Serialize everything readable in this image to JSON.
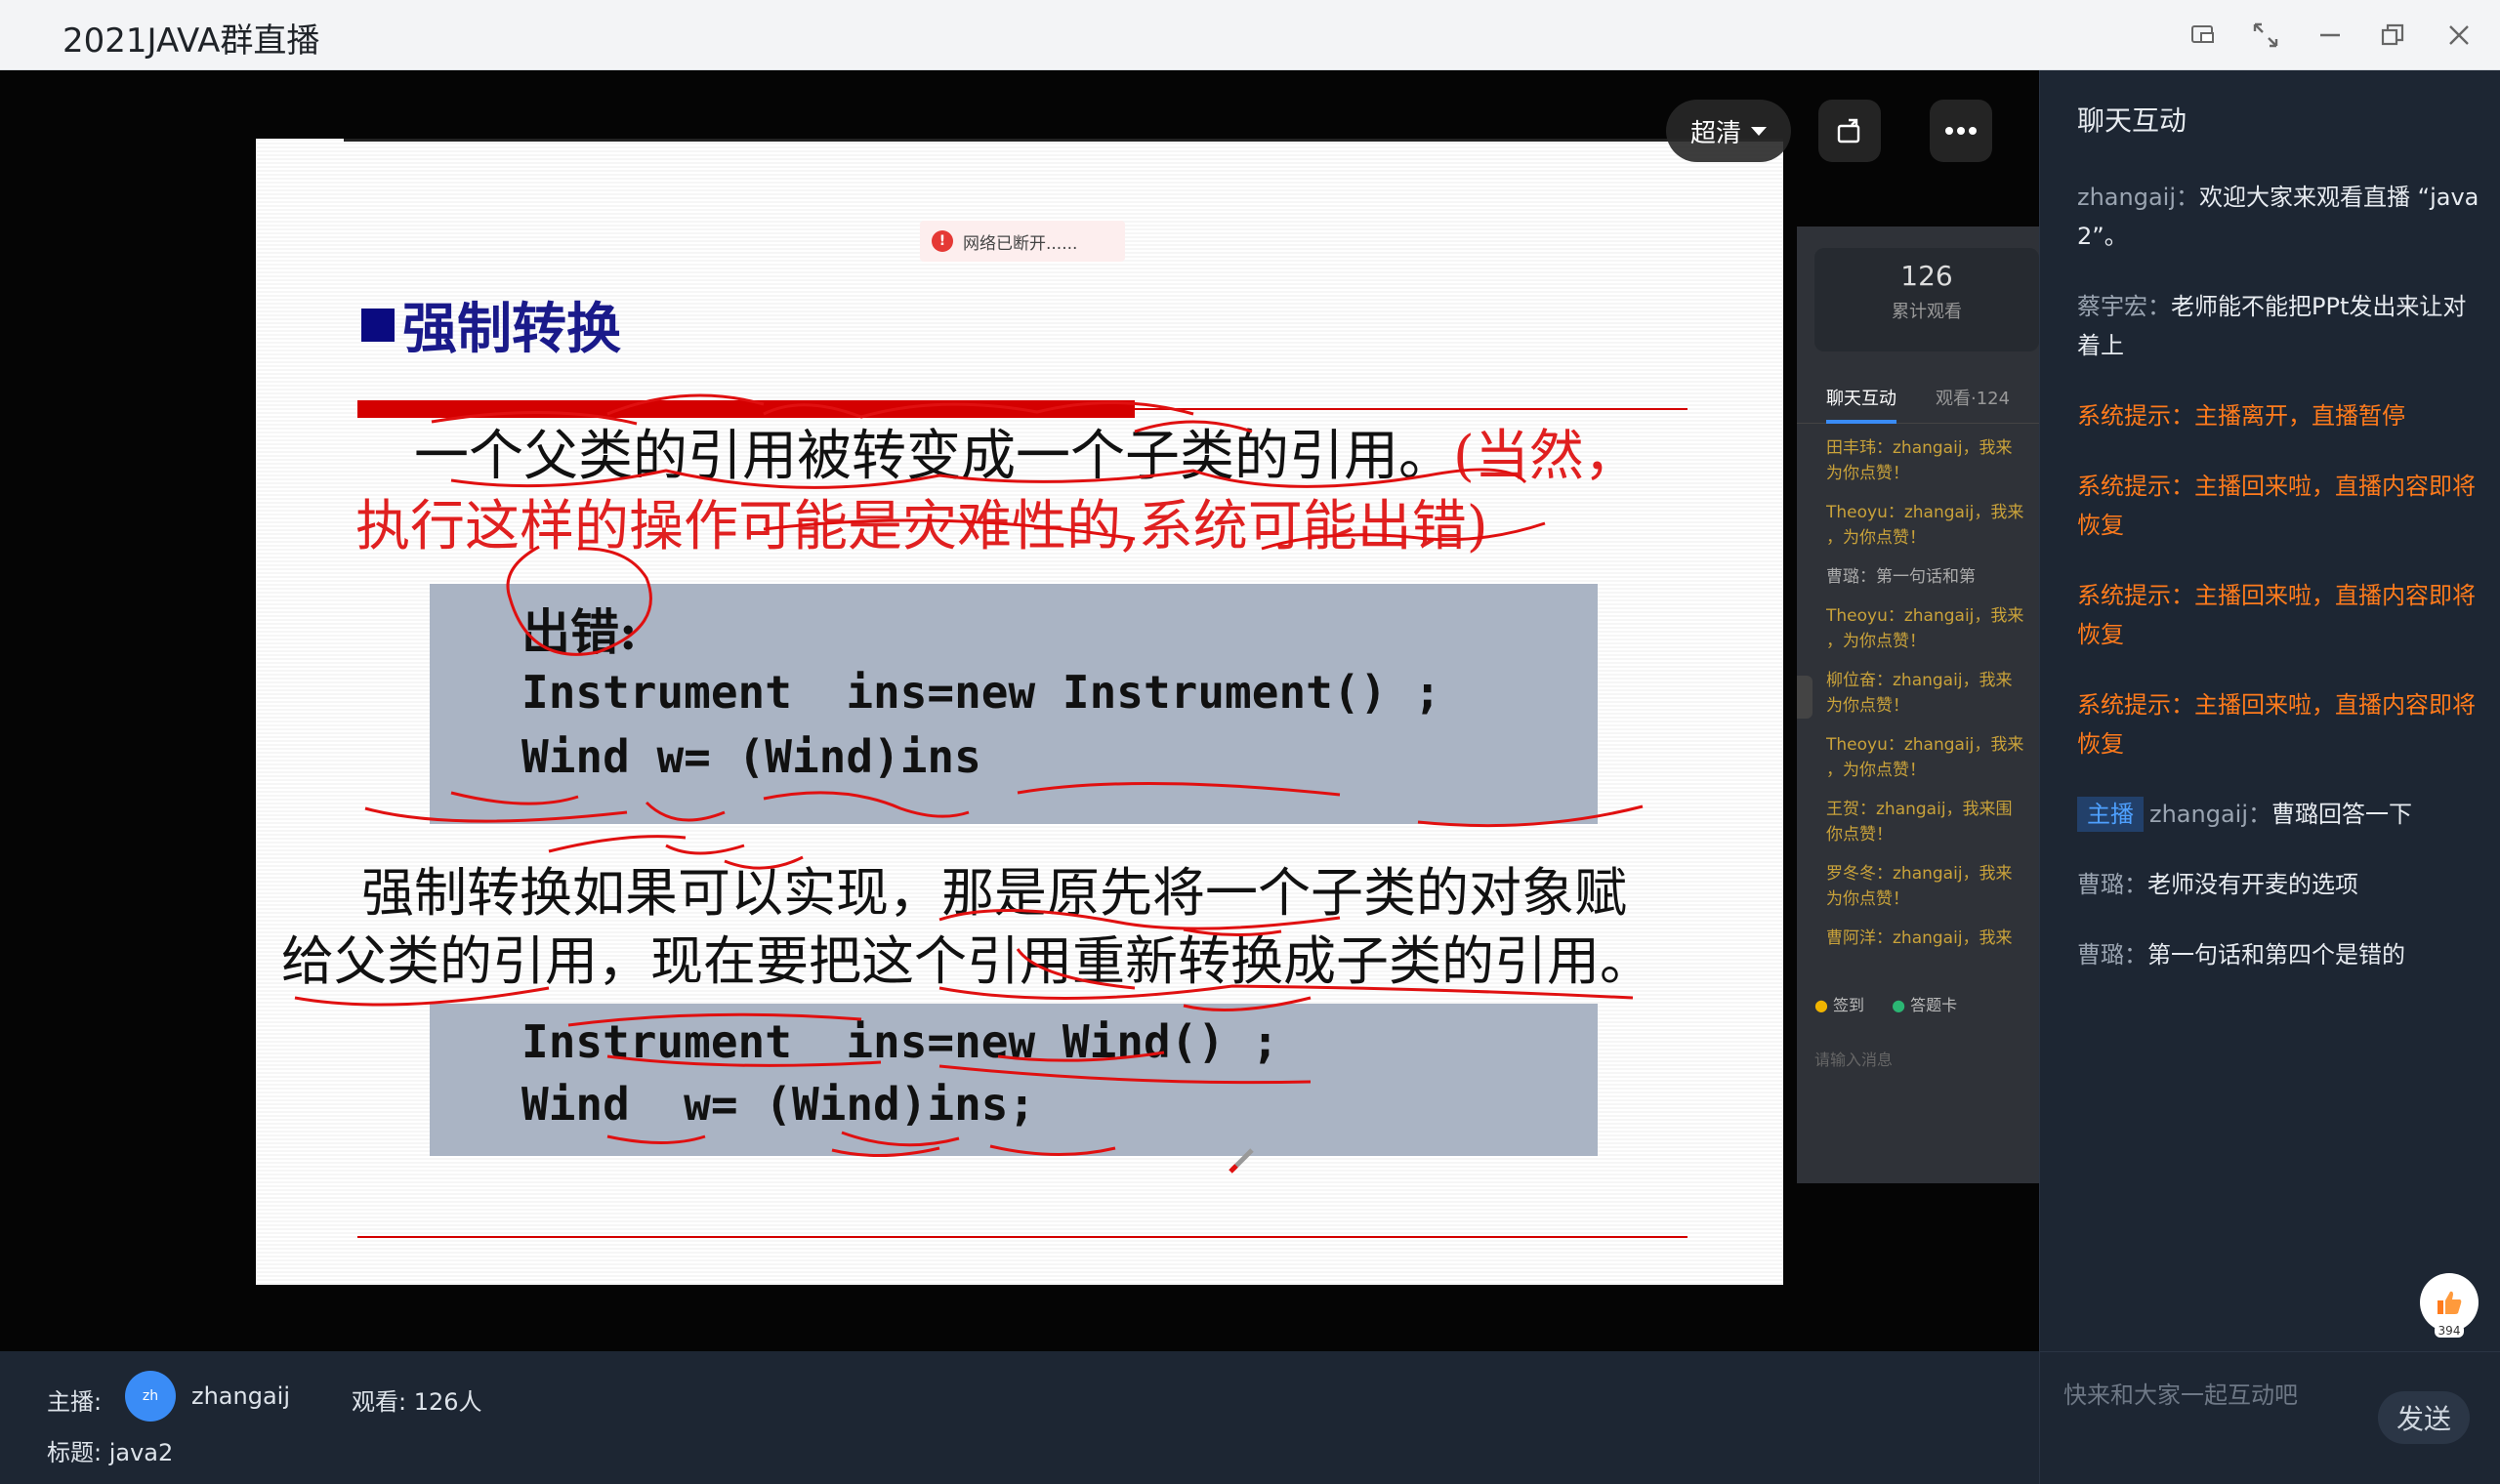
{
  "window": {
    "title": "2021JAVA群直播",
    "buttons": [
      "picture-in-picture-icon",
      "fullscreen-icon",
      "minimize-icon",
      "restore-icon",
      "close-icon"
    ]
  },
  "player": {
    "quality_label": "超清",
    "network_toast": "网络已断开......"
  },
  "slide": {
    "heading": "强制转换",
    "para1_black": "一个父类的引用被转变成一个子类的引用。",
    "para1_red_a": "(当然，",
    "para1_red_b": "执行这样的操作可能是灾难性的,系统可能出错)",
    "code1_label": "出错:",
    "code1_line1": "Instrument  ins=new Instrument() ;",
    "code1_line2": "Wind w= (Wind)ins",
    "para2_line1": "强制转换如果可以实现，那是原先将一个子类的对象赋",
    "para2_line2": "给父类的引用，现在要把这个引用重新转换成子类的引用。",
    "code2_line1": "Instrument  ins=new Wind() ;",
    "code2_line2": "Wind  w= (Wind)ins;"
  },
  "mini_panel": {
    "count": "126",
    "count_label": "累计观看",
    "tab_chat": "聊天互动",
    "tab_views": "观看·124",
    "messages": [
      "田丰玮：zhangaij，我来",
      "为你点赞！",
      "Theoyu：zhangaij，我来",
      "，为你点赞！",
      "曹璐：第一句话和第",
      "Theoyu：zhangaij，我来",
      "，为你点赞！",
      "柳位奋：zhangaij，我来",
      "为你点赞！",
      "Theoyu：zhangaij，我来",
      "，为你点赞！",
      "王贺：zhangaij，我来围",
      "你点赞！",
      "罗冬冬：zhangaij，我来",
      "为你点赞！",
      "曹阿洋：zhangaij，我来"
    ],
    "btn_signin": "签到",
    "btn_answer": "答题卡",
    "input_placeholder": "请输入消息"
  },
  "info_bar": {
    "host_label": "主播:",
    "avatar_text": "zh",
    "host_name": "zhangaij",
    "views": "观看: 126人",
    "topic": "标题: java2"
  },
  "chat": {
    "header": "聊天互动",
    "items": [
      {
        "user": "zhangaij：",
        "text": "欢迎大家来观看直播 “java 2”。",
        "type": "normal"
      },
      {
        "user": "蔡宇宏：",
        "text": "老师能不能把PPt发出来让对着上",
        "type": "normal"
      },
      {
        "user": "",
        "text": "系统提示：主播离开，直播暂停",
        "type": "system"
      },
      {
        "user": "",
        "text": "系统提示：主播回来啦，直播内容即将恢复",
        "type": "system"
      },
      {
        "user": "",
        "text": "系统提示：主播回来啦，直播内容即将恢复",
        "type": "system"
      },
      {
        "user": "",
        "text": "系统提示：主播回来啦，直播内容即将恢复",
        "type": "system"
      },
      {
        "tag": "主播",
        "user": "zhangaij：",
        "text": "曹璐回答一下",
        "type": "host"
      },
      {
        "user": "曹璐：",
        "text": "老师没有开麦的选项",
        "type": "normal"
      },
      {
        "user": "曹璐：",
        "text": "第一句话和第四个是错的",
        "type": "normal"
      }
    ],
    "like_count": "394",
    "input_placeholder": "快来和大家一起互动吧",
    "send_label": "发送"
  }
}
